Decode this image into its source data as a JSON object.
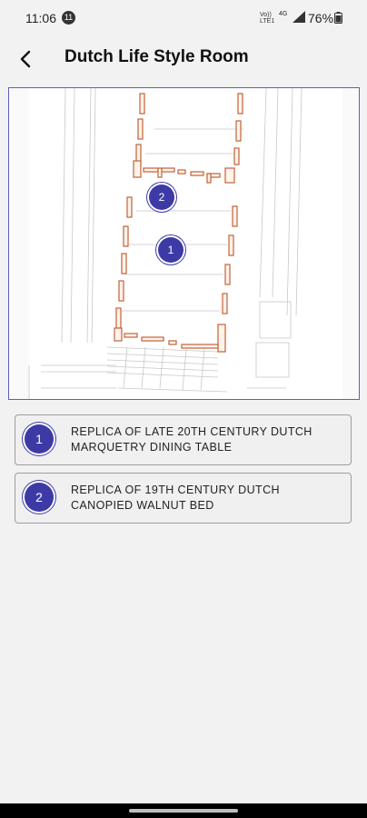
{
  "status": {
    "time": "11:06",
    "notification_count": "11",
    "network_top": "Vo))",
    "network_mid": "LTE1",
    "network_type": "4G",
    "battery": "76%"
  },
  "header": {
    "title": "Dutch Life Style Room",
    "back_icon": "back-arrow-icon"
  },
  "map": {
    "markers": [
      {
        "number": "1"
      },
      {
        "number": "2"
      }
    ]
  },
  "exhibits": [
    {
      "number": "1",
      "title": "REPLICA OF LATE 20TH CENTURY DUTCH MARQUETRY DINING TABLE"
    },
    {
      "number": "2",
      "title": "REPLICA OF 19TH CENTURY DUTCH CANOPIED WALNUT BED"
    }
  ],
  "colors": {
    "accent": "#3d3aa6",
    "map_border": "#5b5fbf",
    "wall_outline": "#c0623a"
  }
}
